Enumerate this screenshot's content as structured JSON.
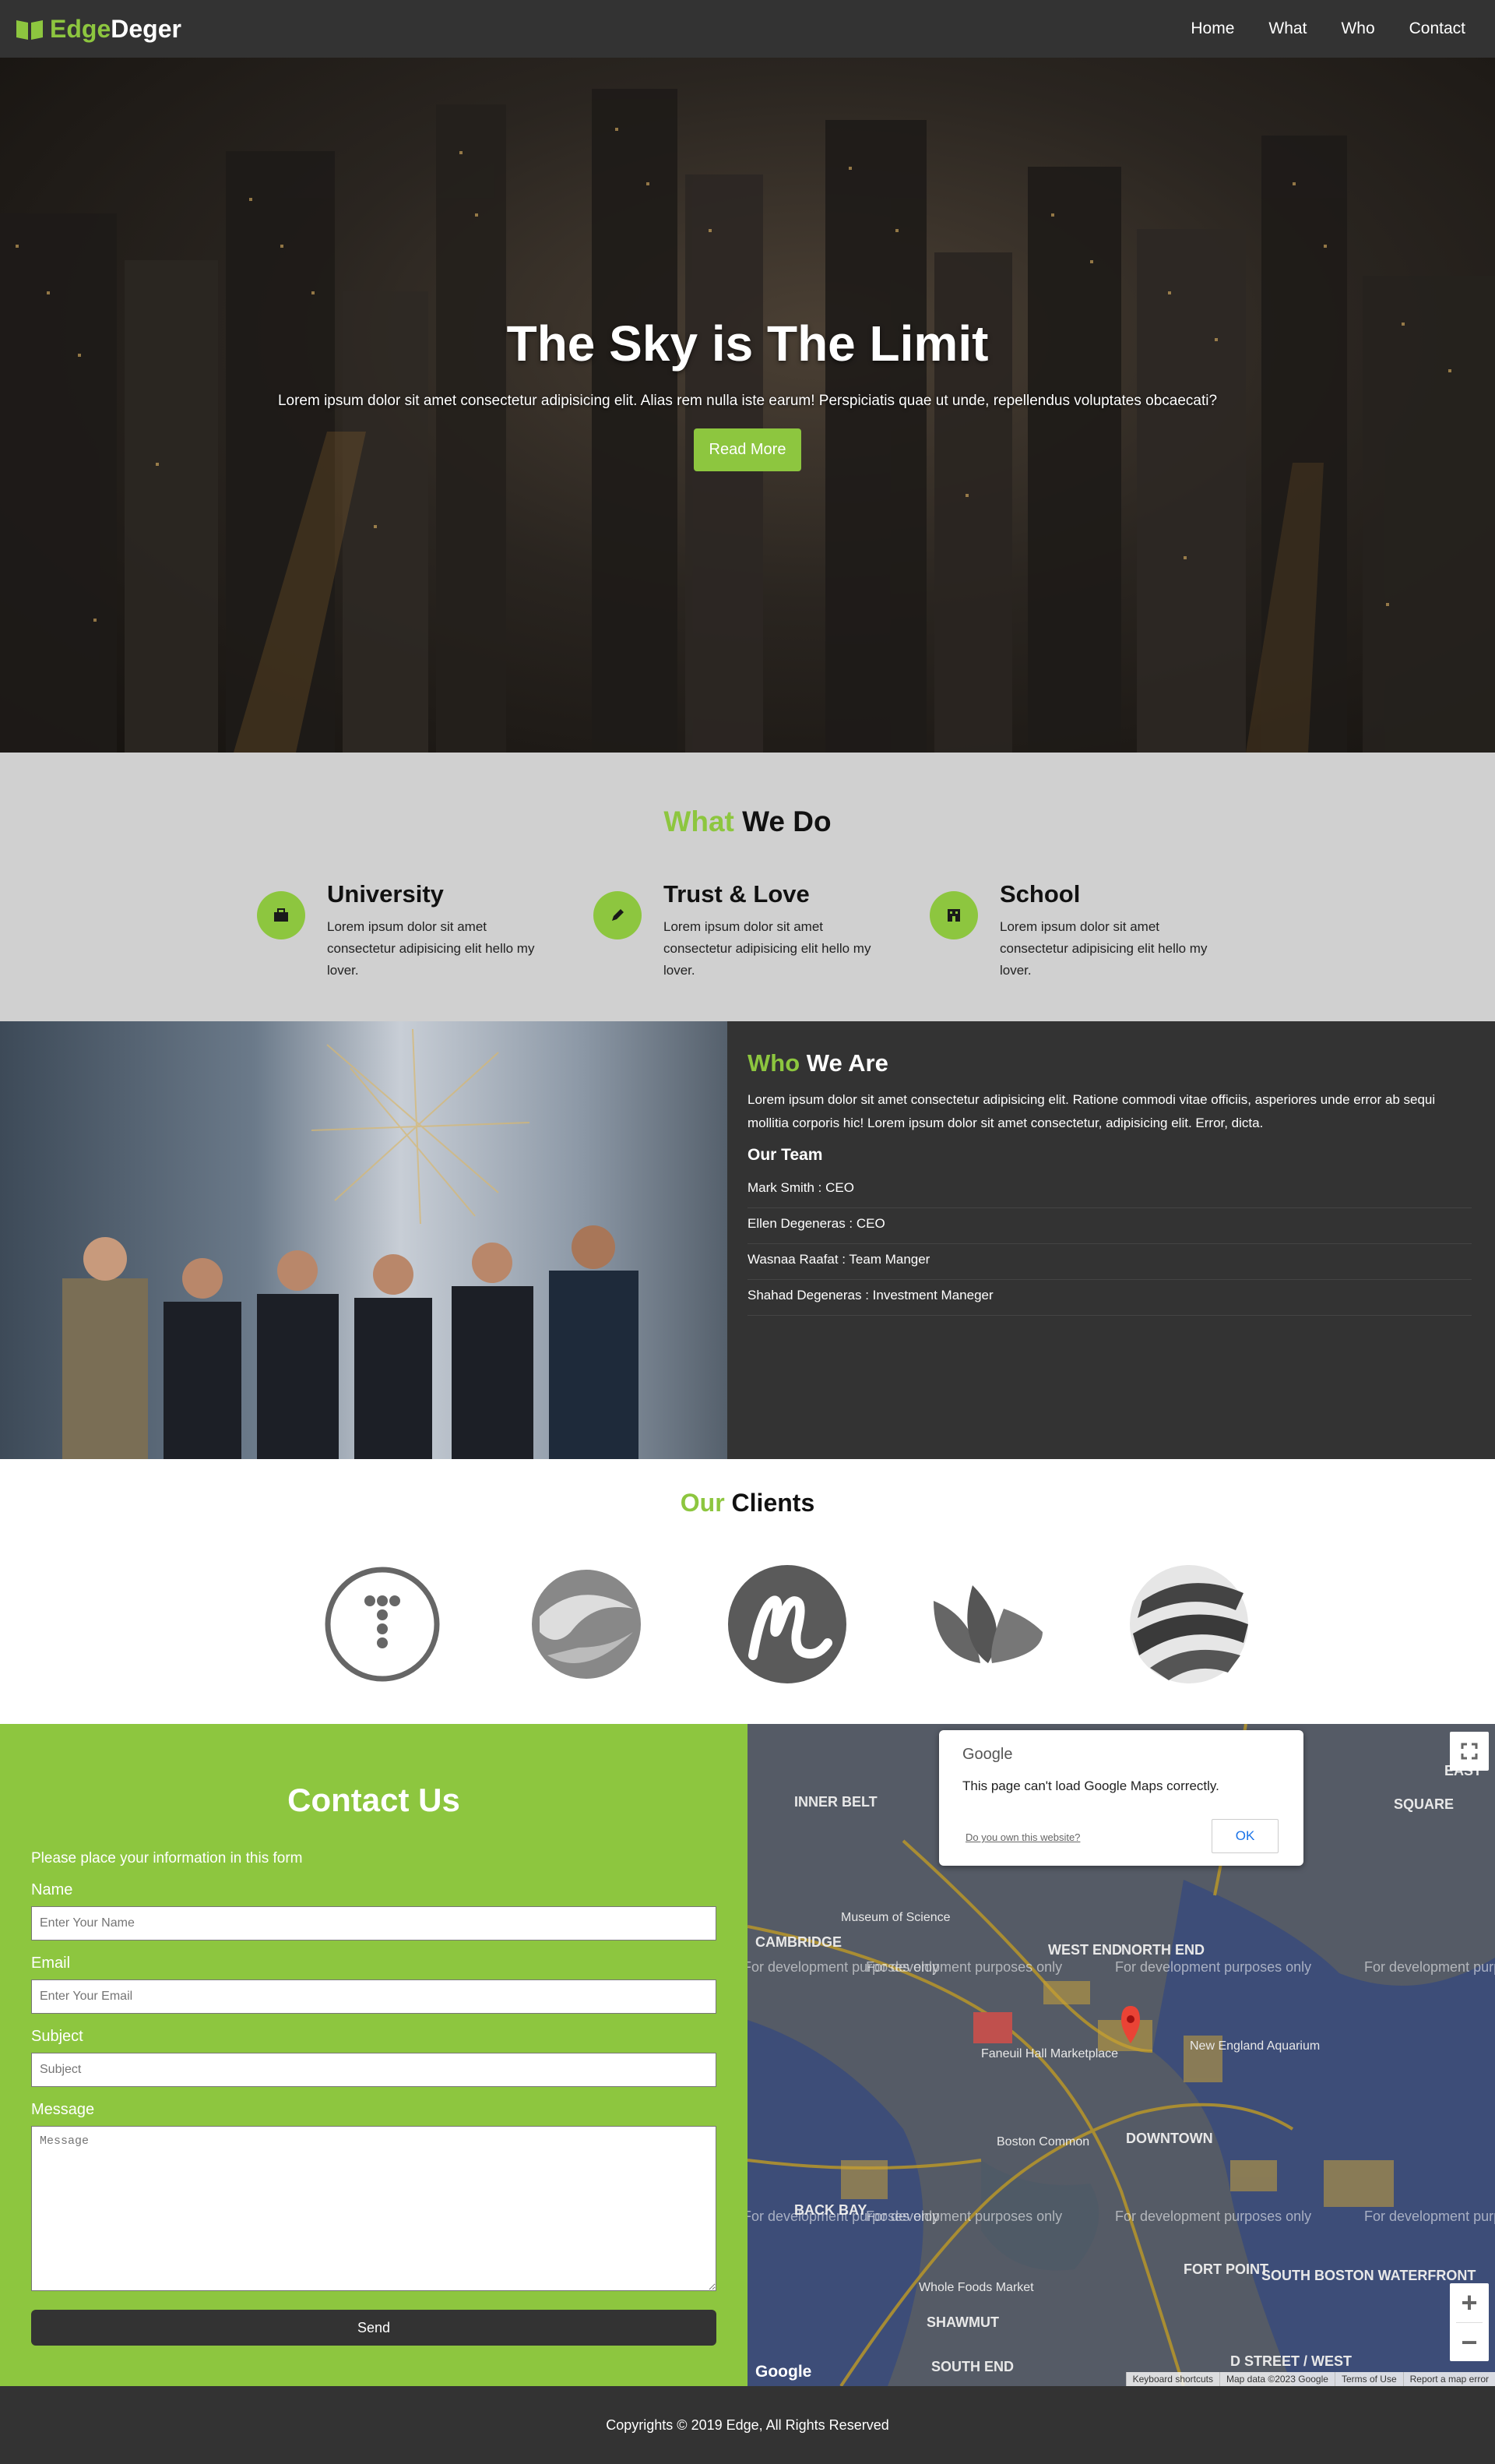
{
  "brand": {
    "part1": "Edge",
    "part2": "Deger",
    "icon": "open-book-icon"
  },
  "nav": {
    "items": [
      "Home",
      "What",
      "Who",
      "Contact"
    ]
  },
  "hero": {
    "title": "The Sky is The Limit",
    "text": "Lorem ipsum dolor sit amet consectetur adipisicing elit. Alias rem nulla iste earum! Perspiciatis quae ut unde, repellendus voluptates obcaecati?",
    "button": "Read More"
  },
  "what": {
    "title_accent": "What",
    "title_rest": "We Do",
    "services": [
      {
        "title": "University",
        "icon": "briefcase-icon",
        "text": "Lorem ipsum dolor sit amet consectetur adipisicing elit hello my lover."
      },
      {
        "title": "Trust & Love",
        "icon": "pencil-icon",
        "text": "Lorem ipsum dolor sit amet consectetur adipisicing elit hello my lover."
      },
      {
        "title": "School",
        "icon": "building-icon",
        "text": "Lorem ipsum dolor sit amet consectetur adipisicing elit hello my lover."
      }
    ]
  },
  "who": {
    "title_accent": "Who",
    "title_rest": "We Are",
    "text": "Lorem ipsum dolor sit amet consectetur adipisicing elit. Ratione commodi vitae officiis, asperiores unde error ab sequi mollitia corporis hic! Lorem ipsum dolor sit amet consectetur, adipisicing elit. Error, dicta.",
    "team_title": "Our Team",
    "team": [
      "Mark Smith : CEO",
      "Ellen Degeneras : CEO",
      "Wasnaa Raafat : Team Manger",
      "Shahad Degeneras : Investment Maneger"
    ]
  },
  "clients": {
    "title_accent": "Our",
    "title_rest": "Clients"
  },
  "contact": {
    "title": "Contact Us",
    "intro": "Please place your information in this form",
    "name_label": "Name",
    "name_placeholder": "Enter Your Name",
    "email_label": "Email",
    "email_placeholder": "Enter Your Email",
    "subject_label": "Subject",
    "subject_placeholder": "Subject",
    "message_label": "Message",
    "message_placeholder": "Message",
    "send": "Send"
  },
  "map": {
    "dialog_brand": "Google",
    "dialog_message": "This page can't load Google Maps correctly.",
    "dialog_link": "Do you own this website?",
    "dialog_ok": "OK",
    "watermark": "For development purposes only",
    "logo": "Google",
    "attribution": [
      "Keyboard shortcuts",
      "Map data ©2023 Google",
      "Terms of Use",
      "Report a map error"
    ],
    "labels": {
      "inner_belt": "INNER BELT",
      "east": "EAST",
      "cambridge": "CAMBRIDGE",
      "end": "END",
      "west_end": "WEST END",
      "north_end": "NORTH END",
      "faneuil": "Faneuil Hall Marketplace",
      "aquarium": "New England Aquarium",
      "downtown": "DOWNTOWN",
      "back_bay": "BACK BAY",
      "fort_point": "FORT POINT",
      "south_boston": "SOUTH BOSTON WATERFRONT",
      "shawmut": "SHAWMUT",
      "south_end": "SOUTH END",
      "museum": "Museum of Science",
      "boston_common": "Boston Common",
      "whole_foods": "Whole Foods Market",
      "square": "SQUARE",
      "d_street": "D STREET / WEST"
    }
  },
  "footer": {
    "text": "Copyrights © 2019 Edge, All Rights Reserved"
  }
}
